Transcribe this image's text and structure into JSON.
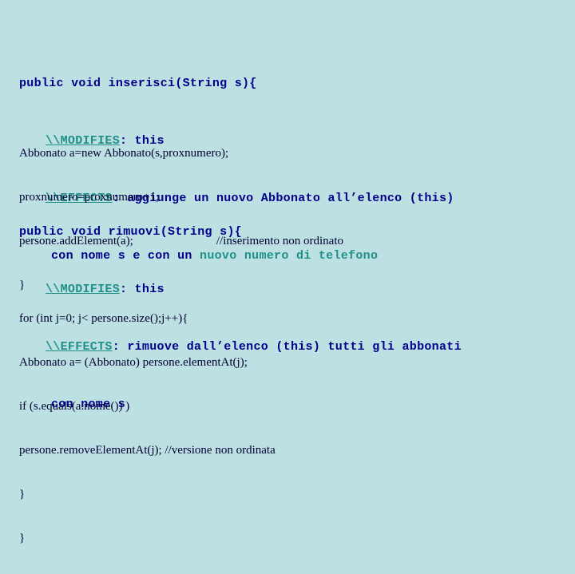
{
  "slide": {
    "background_color": "#bde0e3",
    "spec_tag_color": "#1f8f88",
    "code_color": "#00008b",
    "highlight_color": "#1f9189",
    "serif_color": "#000033"
  },
  "method_insert": {
    "signature": "public void inserisci(String s){",
    "modifies_tag": "\\\\MODIFIES",
    "modifies_text": ": this",
    "effects_tag": "\\\\EFFECTS",
    "effects_text_a": ": aggiunge un nuovo Abbonato all’elenco (this)",
    "effects_text_b": "con nome s e con un ",
    "effects_text_b_highlight": "nuovo numero di telefono",
    "body": [
      "Abbonato a=new Abbonato(s,proxnumero);",
      "proxnumero=proxnumero+1;"
    ],
    "body_comment_line": "persone.addElement(a);",
    "body_comment": "//inserimento non ordinato",
    "closing_brace": "}"
  },
  "method_remove": {
    "signature": "public void rimuovi(String s){",
    "modifies_tag": "\\\\MODIFIES",
    "modifies_text": ": this",
    "effects_tag": "\\\\EFFECTS",
    "effects_text_a": ": rimuove dall’elenco (this) tutti gli abbonati",
    "effects_text_b": "con nome s",
    "body": [
      "for (int j=0; j< persone.size();j++){",
      "Abbonato a= (Abbonato) persone.elementAt(j);",
      "if (s.equals(a.nome()) )",
      "persone.removeElementAt(j); //versione non ordinata",
      "}",
      "}"
    ]
  }
}
